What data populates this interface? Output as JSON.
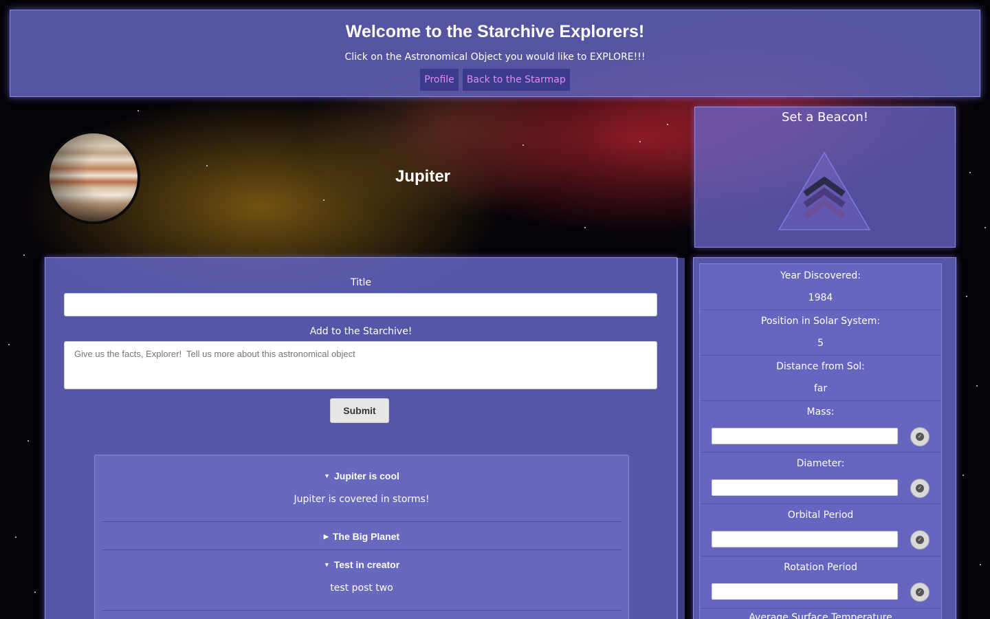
{
  "header": {
    "title": "Welcome to the Starchive Explorers!",
    "subtitle": "Click on the Astronomical Object you would like to EXPLORE!!!",
    "nav": [
      "Profile",
      "Back to the Starmap"
    ]
  },
  "object": {
    "name": "Jupiter",
    "image": "jupiter-planet-image"
  },
  "beacon": {
    "title": "Set a Beacon!",
    "icon": "beacon-chevron-triangle-icon"
  },
  "form": {
    "title_label": "Title",
    "title_value": "",
    "body_label": "Add to the Starchive!",
    "body_placeholder": "Give us the facts, Explorer!  Tell us more about this astronomical object",
    "submit_label": "Submit"
  },
  "posts": [
    {
      "title": "Jupiter is cool",
      "expanded": true,
      "body": "Jupiter is covered in storms!"
    },
    {
      "title": "The Big Planet",
      "expanded": false,
      "body": ""
    },
    {
      "title": "Test in creator",
      "expanded": true,
      "body": "test post two"
    }
  ],
  "stats": {
    "year_label": "Year Discovered:",
    "year_value": "1984",
    "position_label": "Position in Solar System:",
    "position_value": "5",
    "distance_label": "Distance from Sol:",
    "distance_value": "far",
    "mass_label": "Mass:",
    "diameter_label": "Diameter:",
    "orbital_label": "Orbital Period",
    "rotation_label": "Rotation Period",
    "temp_label": "Average Surface Temperature"
  },
  "colors": {
    "panel": "#6060b6",
    "nav_bg": "#3c3a8c",
    "nav_text": "#e28cf2"
  }
}
